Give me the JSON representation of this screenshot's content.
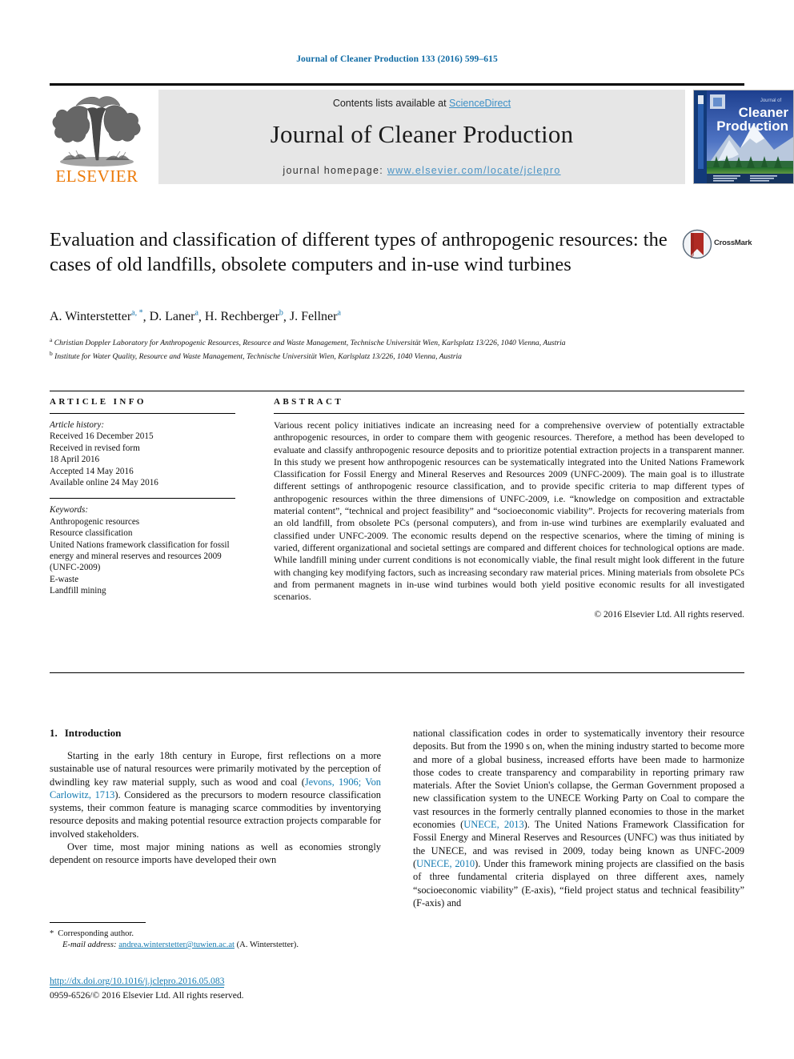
{
  "running_head": "Journal of Cleaner Production 133 (2016) 599–615",
  "masthead": {
    "contents_prefix": "Contents lists available at ",
    "sciencedirect": "ScienceDirect",
    "journal_title": "Journal of Cleaner Production",
    "homepage_prefix": "journal homepage: ",
    "homepage_url": "www.elsevier.com/locate/jclepro",
    "publisher": "ELSEVIER",
    "cover_title_line1": "Cleaner",
    "cover_title_line2": "Production",
    "cover_kicker": "Journal of"
  },
  "colors": {
    "link_blue": "#1279b0",
    "header_blue": "#0f6ba5",
    "homepage_blue": "#4a93c4",
    "sciencedirect_blue": "#3d90c6",
    "elsevier_orange": "#ec7a08",
    "band_grey": "#e6e6e6",
    "crossmark_red": "#b02b24"
  },
  "article": {
    "title": "Evaluation and classification of different types of anthropogenic resources: the cases of old landfills, obsolete computers and in-use wind turbines",
    "crossmark_label": "CrossMark",
    "authors": [
      {
        "name": "A. Winterstetter",
        "marks": "a, *"
      },
      {
        "name": "D. Laner",
        "marks": "a"
      },
      {
        "name": "H. Rechberger",
        "marks": "b"
      },
      {
        "name": "J. Fellner",
        "marks": "a"
      }
    ],
    "affiliations": [
      {
        "mark": "a",
        "text": "Christian Doppler Laboratory for Anthropogenic Resources, Resource and Waste Management, Technische Universität Wien, Karlsplatz 13/226, 1040 Vienna, Austria"
      },
      {
        "mark": "b",
        "text": "Institute for Water Quality, Resource and Waste Management, Technische Universität Wien, Karlsplatz 13/226, 1040 Vienna, Austria"
      }
    ]
  },
  "article_info": {
    "heading": "ARTICLE INFO",
    "history_label": "Article history:",
    "history": [
      "Received 16 December 2015",
      "Received in revised form",
      "18 April 2016",
      "Accepted 14 May 2016",
      "Available online 24 May 2016"
    ],
    "keywords_label": "Keywords:",
    "keywords": [
      "Anthropogenic resources",
      "Resource classification",
      "United Nations framework classification for fossil energy and mineral reserves and resources 2009 (UNFC-2009)",
      "E-waste",
      "Landfill mining"
    ]
  },
  "abstract": {
    "heading": "ABSTRACT",
    "text": "Various recent policy initiatives indicate an increasing need for a comprehensive overview of potentially extractable anthropogenic resources, in order to compare them with geogenic resources. Therefore, a method has been developed to evaluate and classify anthropogenic resource deposits and to prioritize potential extraction projects in a transparent manner. In this study we present how anthropogenic resources can be systematically integrated into the United Nations Framework Classification for Fossil Energy and Mineral Reserves and Resources 2009 (UNFC-2009). The main goal is to illustrate different settings of anthropogenic resource classification, and to provide specific criteria to map different types of anthropogenic resources within the three dimensions of UNFC-2009, i.e. “knowledge on composition and extractable material content”, “technical and project feasibility” and “socioeconomic viability”. Projects for recovering materials from an old landfill, from obsolete PCs (personal computers), and from in-use wind turbines are exemplarily evaluated and classified under UNFC-2009. The economic results depend on the respective scenarios, where the timing of mining is varied, different organizational and societal settings are compared and different choices for technological options are made. While landfill mining under current conditions is not economically viable, the final result might look different in the future with changing key modifying factors, such as increasing secondary raw material prices. Mining materials from obsolete PCs and from permanent magnets in in-use wind turbines would both yield positive economic results for all investigated scenarios.",
    "copyright": "© 2016 Elsevier Ltd. All rights reserved."
  },
  "introduction": {
    "number": "1.",
    "heading": "Introduction",
    "left_para1_a": "Starting in the early 18th century in Europe, first reflections on a more sustainable use of natural resources were primarily motivated by the perception of dwindling key raw material supply, such as wood and coal (",
    "left_para1_ref": "Jevons, 1906; Von Carlowitz, 1713",
    "left_para1_b": "). Considered as the precursors to modern resource classification systems, their common feature is managing scarce commodities by inventorying resource deposits and making potential resource extraction projects comparable for involved stakeholders.",
    "left_para2": "Over time, most major mining nations as well as economies strongly dependent on resource imports have developed their own",
    "right_para_a": "national classification codes in order to systematically inventory their resource deposits. But from the 1990 s on, when the mining industry started to become more and more of a global business, increased efforts have been made to harmonize those codes to create transparency and comparability in reporting primary raw materials. After the Soviet Union's collapse, the German Government proposed a new classification system to the UNECE Working Party on Coal to compare the vast resources in the formerly centrally planned economies to those in the market economies (",
    "right_ref1": "UNECE, 2013",
    "right_para_b": "). The United Nations Framework Classification for Fossil Energy and Mineral Reserves and Resources (UNFC) was thus initiated by the UNECE, and was revised in 2009, today being known as UNFC-2009 (",
    "right_ref2": "UNECE, 2010",
    "right_para_c": "). Under this framework mining projects are classified on the basis of three fundamental criteria displayed on three different axes, namely “socioeconomic viability” (E-axis), “field project status and technical feasibility” (F-axis) and"
  },
  "footnote": {
    "star": "*",
    "corresponding": "Corresponding author.",
    "email_label": "E-mail address:",
    "email": "andrea.winterstetter@tuwien.ac.at",
    "email_suffix": "(A. Winterstetter)."
  },
  "footer": {
    "doi": "http://dx.doi.org/10.1016/j.jclepro.2016.05.083",
    "issn_copyright": "0959-6526/© 2016 Elsevier Ltd. All rights reserved."
  }
}
